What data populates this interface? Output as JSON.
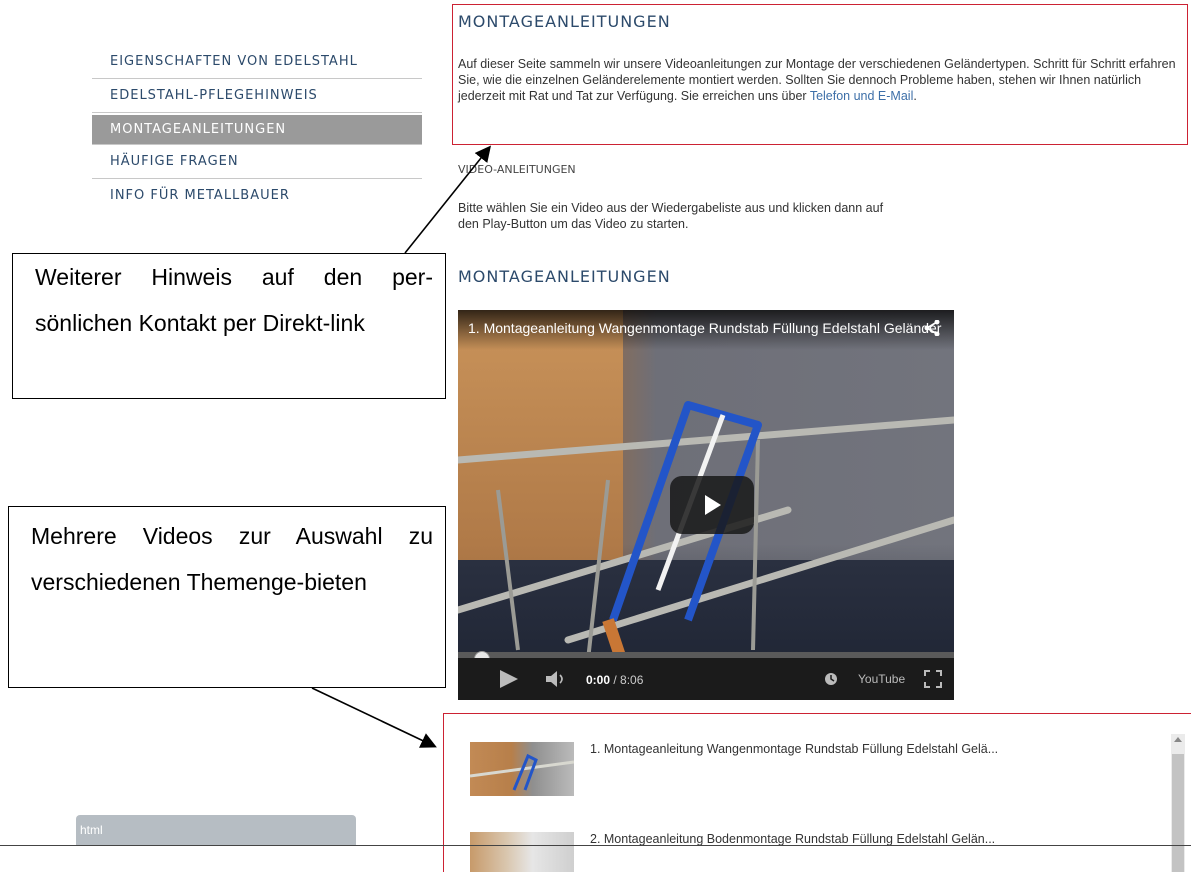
{
  "nav": {
    "items": [
      {
        "label": "EIGENSCHAFTEN VON EDELSTAHL",
        "active": false
      },
      {
        "label": "EDELSTAHL-PFLEGEHINWEIS",
        "active": false
      },
      {
        "label": "MONTAGEANLEITUNGEN",
        "active": true
      },
      {
        "label": "HÄUFIGE FRAGEN",
        "active": false
      },
      {
        "label": "INFO FÜR METALLBAUER",
        "active": false
      }
    ]
  },
  "intro": {
    "title": "MONTAGEANLEITUNGEN",
    "text": "Auf dieser Seite sammeln wir unsere Videoanleitungen zur Montage der verschiedenen Geländertypen. Schritt für Schritt erfahren Sie, wie die einzelnen Geländerelemente montiert werden. Sollten Sie dennoch Probleme haben, stehen wir Ihnen natürlich jederzeit mit Rat und Tat zur Verfügung. Sie erreichen uns über",
    "link": "Telefon und E-Mail",
    "end": "."
  },
  "video_section": {
    "subtitle": "VIDEO-ANLEITUNGEN",
    "instructions": "Bitte wählen Sie ein Video aus der Wiedergabeliste aus und klicken dann auf den Play-Button um das Video zu starten.",
    "heading": "MONTAGEANLEITUNGEN"
  },
  "player": {
    "title": "1. Montageanleitung Wangenmontage Rundstab Füllung Edelstahl Geländer",
    "time_current": "0:00",
    "time_total": " / 8:06",
    "progress": 0,
    "brand": "YouTube"
  },
  "playlist": {
    "items": [
      {
        "title": "1. Montageanleitung Wangenmontage Rundstab Füllung Edelstahl Gelä..."
      },
      {
        "title": "2. Montageanleitung Bodenmontage Rundstab Füllung Edelstahl Gelän..."
      }
    ]
  },
  "annotations": {
    "contact": "Weiterer Hinweis auf den per-sönlichen Kontakt per Direkt-link",
    "videos": "Mehrere Videos zur Auswahl zu verschiedenen Themenge-bieten"
  },
  "bottom_tab": {
    "label": "html"
  },
  "colors": {
    "accent_red": "#cc2233",
    "nav_text": "#2c4a6b",
    "active_nav_bg": "#9a9a9a",
    "link": "#3d6fa8"
  }
}
